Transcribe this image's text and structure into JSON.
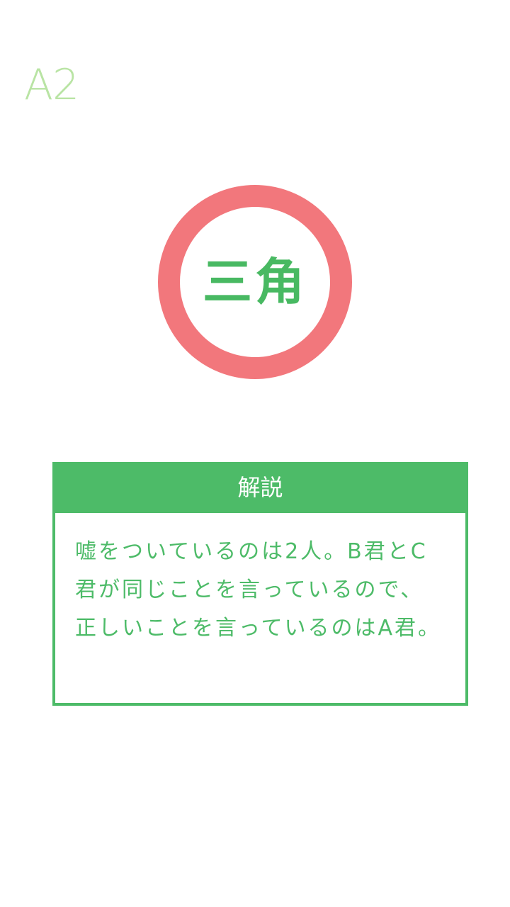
{
  "quiz": {
    "question_number": "A2",
    "answer": "三角"
  },
  "explanation": {
    "header": "解説",
    "body": "嘘をついているのは2人。B君とC君が同じことを言っているので、正しいことを言っているのはA君。"
  },
  "colors": {
    "accent_green": "#4dbb68",
    "answer_green": "#48b962",
    "light_green": "#b9e4a4",
    "ring_red": "#f2777c",
    "background": "#ffffff"
  }
}
